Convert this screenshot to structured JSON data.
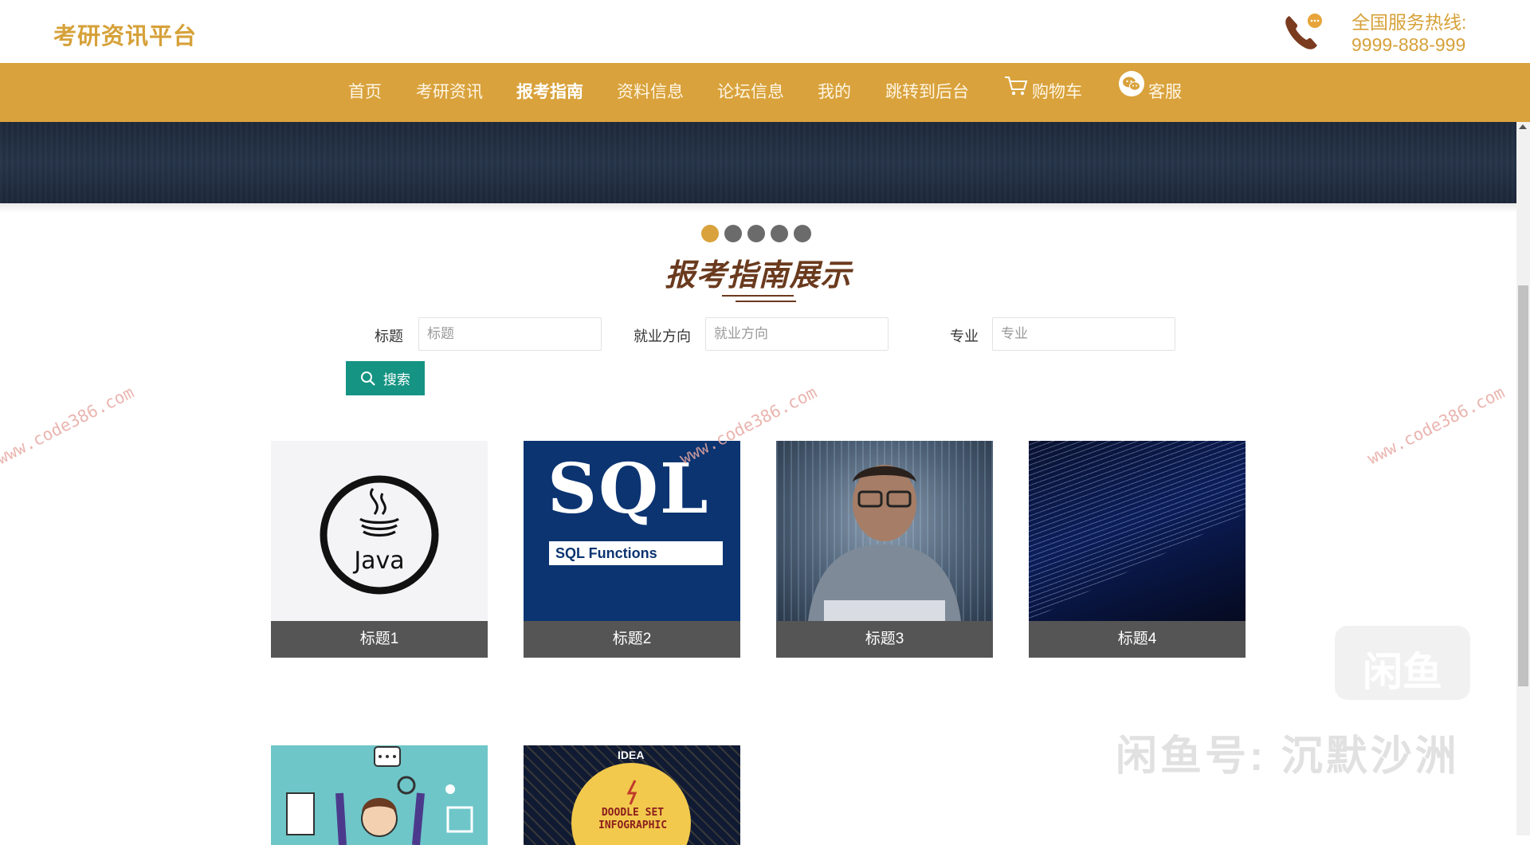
{
  "header": {
    "logo": "考研资讯平台",
    "hotline_label": "全国服务热线:",
    "hotline_number": "9999-888-999"
  },
  "nav": {
    "items": [
      {
        "label": "首页"
      },
      {
        "label": "考研资讯"
      },
      {
        "label": "报考指南",
        "active": true
      },
      {
        "label": "资料信息"
      },
      {
        "label": "论坛信息"
      },
      {
        "label": "我的"
      },
      {
        "label": "跳转到后台"
      },
      {
        "label": "购物车",
        "icon": "cart-icon"
      },
      {
        "label": "客服",
        "icon": "wechat-icon"
      }
    ]
  },
  "carousel": {
    "dot_count": 5,
    "active_index": 0,
    "active_color": "#d9a23c",
    "inactive_color": "#6b6b6b"
  },
  "section": {
    "title": "报考指南展示"
  },
  "search": {
    "fields": [
      {
        "label": "标题",
        "placeholder": "标题",
        "value": ""
      },
      {
        "label": "就业方向",
        "placeholder": "就业方向",
        "value": ""
      },
      {
        "label": "专业",
        "placeholder": "专业",
        "value": ""
      }
    ],
    "button_label": "搜索",
    "button_color": "#159483"
  },
  "cards": [
    {
      "title": "标题1",
      "image": "java-logo"
    },
    {
      "title": "标题2",
      "image": "sql-functions",
      "image_text_big": "SQL",
      "image_text_small": "SQL Functions"
    },
    {
      "title": "标题3",
      "image": "programmer-matrix"
    },
    {
      "title": "标题4",
      "image": "code-wall"
    },
    {
      "title": "",
      "image": "cartoon-person"
    },
    {
      "title": "",
      "image": "doodle-infographic",
      "image_text_top": "IDEA",
      "image_text_center": "DOODLE SET INFOGRAPHIC"
    }
  ],
  "watermarks": {
    "site": "www.code386.com",
    "app": "闲鱼号: 沉默沙洲",
    "app_logo": "闲鱼"
  },
  "colors": {
    "brand": "#d9a23c",
    "title": "#6a3a1e",
    "caption_bg": "#555555"
  }
}
